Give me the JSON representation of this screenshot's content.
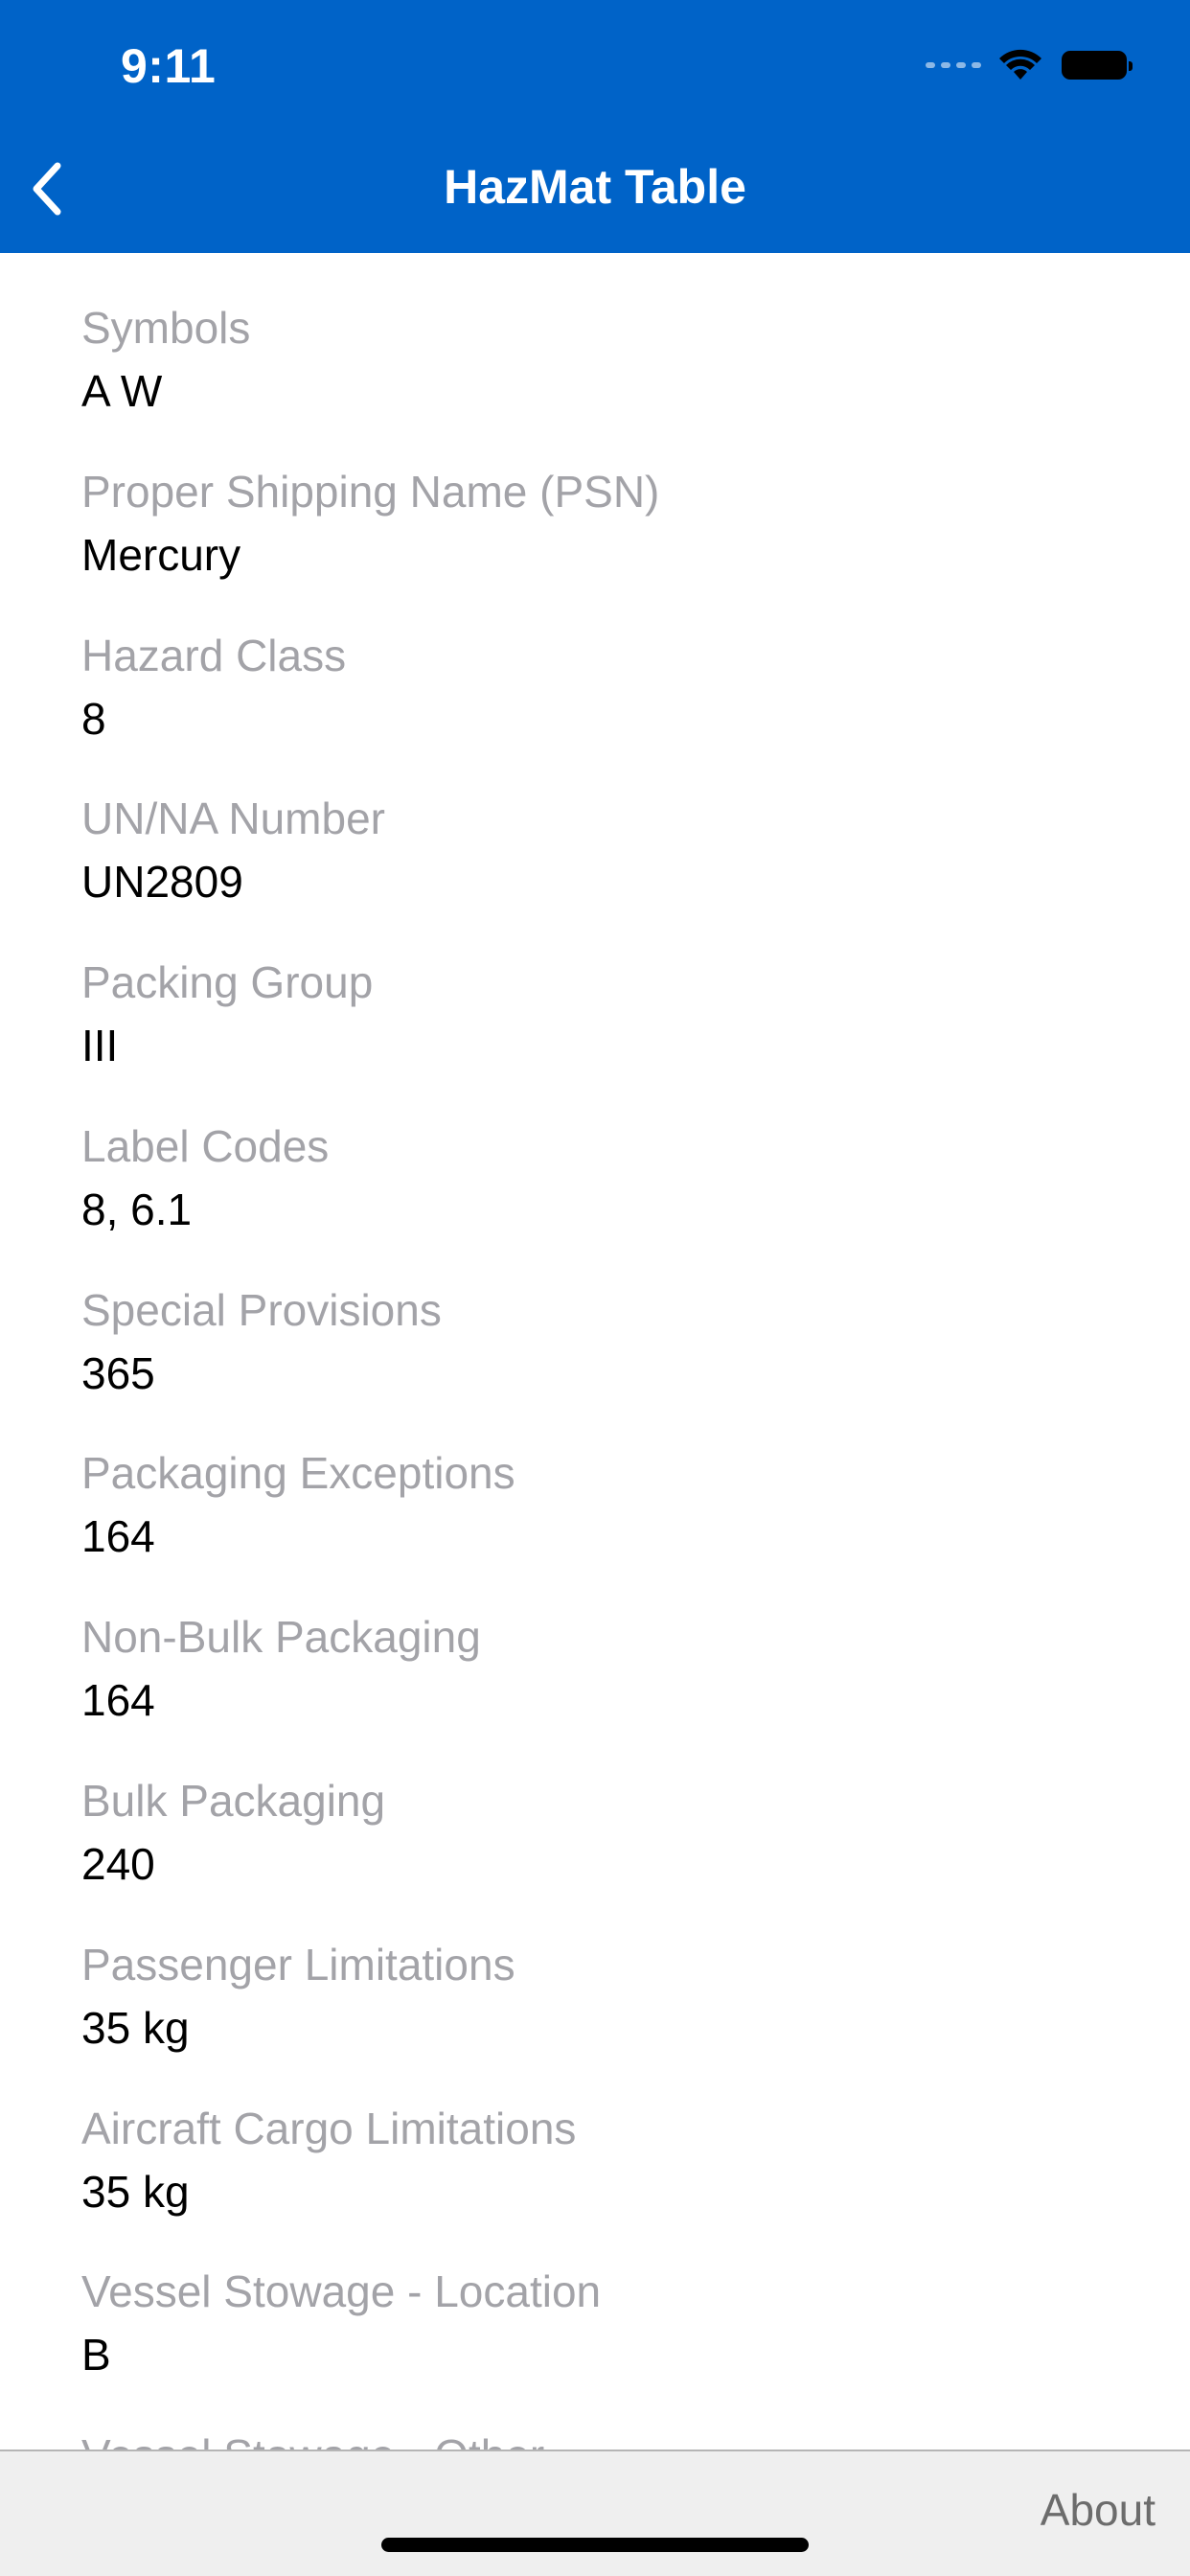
{
  "status_bar": {
    "time": "9:11"
  },
  "nav": {
    "title": "HazMat Table"
  },
  "fields": [
    {
      "label": "Symbols",
      "value": "A W"
    },
    {
      "label": "Proper Shipping Name (PSN)",
      "value": "Mercury"
    },
    {
      "label": "Hazard Class",
      "value": "8"
    },
    {
      "label": "UN/NA Number",
      "value": "UN2809"
    },
    {
      "label": "Packing Group",
      "value": "III"
    },
    {
      "label": "Label Codes",
      "value": "8, 6.1"
    },
    {
      "label": "Special Provisions",
      "value": "365"
    },
    {
      "label": "Packaging Exceptions",
      "value": "164"
    },
    {
      "label": "Non-Bulk Packaging",
      "value": "164"
    },
    {
      "label": "Bulk Packaging",
      "value": "240"
    },
    {
      "label": "Passenger Limitations",
      "value": "35 kg"
    },
    {
      "label": "Aircraft Cargo Limitations",
      "value": "35 kg"
    },
    {
      "label": "Vessel Stowage - Location",
      "value": "B"
    },
    {
      "label": "Vessel Stowage - Other",
      "value": ""
    }
  ],
  "footer": {
    "about_label": "About"
  },
  "colors": {
    "header_background": "#0063c8",
    "label_text": "#a3a3a8",
    "value_text": "#000000",
    "footer_background": "#efefef"
  },
  "icons": {
    "back": "chevron-left-icon",
    "wifi": "wifi-icon",
    "battery": "battery-icon",
    "signal": "cellular-signal-icon"
  }
}
